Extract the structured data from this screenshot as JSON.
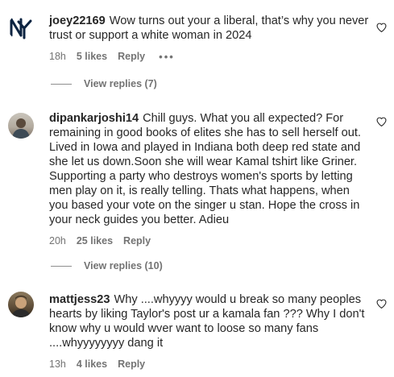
{
  "comments": [
    {
      "username": "joey22169",
      "text": "Wow turns out your a liberal, that’s why you never trust or support a white woman in 2024",
      "time": "18h",
      "likes": "5 likes",
      "reply_label": "Reply",
      "more_label": "•••",
      "view_replies": "View replies (7)"
    },
    {
      "username": "dipankarjoshi14",
      "text": "Chill guys. What you all expected? For remaining in good books of elites she has to sell herself out. Lived in Iowa and played in Indiana both deep red state and she let us down.Soon she will wear Kamal tshirt like Griner. Supporting a party who destroys women's sports by letting men play on it, is really telling. Thats what happens, when you based your vote on the singer u stan. Hope the cross in your neck guides you better. Adieu",
      "time": "20h",
      "likes": "25 likes",
      "reply_label": "Reply",
      "view_replies": "View replies (10)"
    },
    {
      "username": "mattjess23",
      "text": "Why ....whyyyy would u break so many peoples hearts by liking Taylor's post ur a kamala fan ??? Why I don't know why u would wver want to loose so many fans ....whyyyyyyyy dang it",
      "time": "13h",
      "likes": "4 likes",
      "reply_label": "Reply"
    }
  ],
  "colors": {
    "text": "#262626",
    "secondary": "#737373",
    "yankees_navy": "#0c2340"
  }
}
